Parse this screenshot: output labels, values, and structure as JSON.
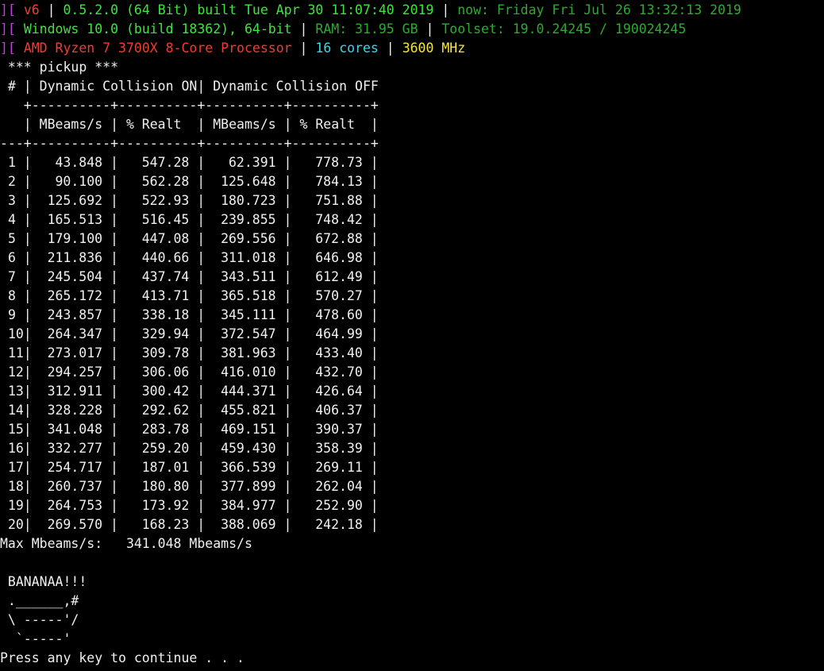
{
  "header": {
    "line1": {
      "bracket": "][",
      "version": "v6",
      "sep1": " | ",
      "build": "0.5.2.0 (64 Bit) built Tue Apr 30 11:07:40 2019",
      "sep2": " | ",
      "now": "now: Friday Fri Jul 26 13:32:13 2019"
    },
    "line2": {
      "bracket": "][",
      "os": "Windows 10.0 (build 18362), 64-bit",
      "sep1": " | ",
      "ram": "RAM: 31.95 GB",
      "sep2": " | ",
      "toolset": "Toolset: 19.0.24245 / 190024245"
    },
    "line3": {
      "bracket": "][",
      "cpu": "AMD Ryzen 7 3700X 8-Core Processor",
      "sep1": " | ",
      "cores": "16 cores",
      "sep2": " | ",
      "mhz": "3600 MHz"
    }
  },
  "scene_line": " *** pickup ***",
  "table": {
    "group_header": " # | Dynamic Collision ON| Dynamic Collision OFF",
    "rule_top": "   +----------+----------+----------+----------+",
    "col_header": "   | MBeams/s | % Realt  | MBeams/s | % Realt  |",
    "rule_mid": "---+----------+----------+----------+----------+",
    "rows": [
      {
        "n": "1",
        "on_mbeams": "43.848",
        "on_realt": "547.28",
        "off_mbeams": "62.391",
        "off_realt": "778.73"
      },
      {
        "n": "2",
        "on_mbeams": "90.100",
        "on_realt": "562.28",
        "off_mbeams": "125.648",
        "off_realt": "784.13"
      },
      {
        "n": "3",
        "on_mbeams": "125.692",
        "on_realt": "522.93",
        "off_mbeams": "180.723",
        "off_realt": "751.88"
      },
      {
        "n": "4",
        "on_mbeams": "165.513",
        "on_realt": "516.45",
        "off_mbeams": "239.855",
        "off_realt": "748.42"
      },
      {
        "n": "5",
        "on_mbeams": "179.100",
        "on_realt": "447.08",
        "off_mbeams": "269.556",
        "off_realt": "672.88"
      },
      {
        "n": "6",
        "on_mbeams": "211.836",
        "on_realt": "440.66",
        "off_mbeams": "311.018",
        "off_realt": "646.98"
      },
      {
        "n": "7",
        "on_mbeams": "245.504",
        "on_realt": "437.74",
        "off_mbeams": "343.511",
        "off_realt": "612.49"
      },
      {
        "n": "8",
        "on_mbeams": "265.172",
        "on_realt": "413.71",
        "off_mbeams": "365.518",
        "off_realt": "570.27"
      },
      {
        "n": "9",
        "on_mbeams": "243.857",
        "on_realt": "338.18",
        "off_mbeams": "345.111",
        "off_realt": "478.60"
      },
      {
        "n": "10",
        "on_mbeams": "264.347",
        "on_realt": "329.94",
        "off_mbeams": "372.547",
        "off_realt": "464.99"
      },
      {
        "n": "11",
        "on_mbeams": "273.017",
        "on_realt": "309.78",
        "off_mbeams": "381.963",
        "off_realt": "433.40"
      },
      {
        "n": "12",
        "on_mbeams": "294.257",
        "on_realt": "306.06",
        "off_mbeams": "416.010",
        "off_realt": "432.70"
      },
      {
        "n": "13",
        "on_mbeams": "312.911",
        "on_realt": "300.42",
        "off_mbeams": "444.371",
        "off_realt": "426.64"
      },
      {
        "n": "14",
        "on_mbeams": "328.228",
        "on_realt": "292.62",
        "off_mbeams": "455.821",
        "off_realt": "406.37"
      },
      {
        "n": "15",
        "on_mbeams": "341.048",
        "on_realt": "283.78",
        "off_mbeams": "469.151",
        "off_realt": "390.37"
      },
      {
        "n": "16",
        "on_mbeams": "332.277",
        "on_realt": "259.20",
        "off_mbeams": "459.430",
        "off_realt": "358.39"
      },
      {
        "n": "17",
        "on_mbeams": "254.717",
        "on_realt": "187.01",
        "off_mbeams": "366.539",
        "off_realt": "269.11"
      },
      {
        "n": "18",
        "on_mbeams": "260.737",
        "on_realt": "180.80",
        "off_mbeams": "377.899",
        "off_realt": "262.04"
      },
      {
        "n": "19",
        "on_mbeams": "264.753",
        "on_realt": "173.92",
        "off_mbeams": "384.977",
        "off_realt": "252.90"
      },
      {
        "n": "20",
        "on_mbeams": "269.570",
        "on_realt": "168.23",
        "off_mbeams": "388.069",
        "off_realt": "242.18"
      }
    ]
  },
  "max_line": "Max Mbeams/s:   341.048 Mbeams/s",
  "ascii_art": [
    " BANANAA!!!",
    " .______,#",
    " \\ -----'/",
    "  `-----'"
  ],
  "prompt": "Press any key to continue . . .",
  "colors": {
    "background": "#000000",
    "text": "#f0f0f0",
    "magenta": "#c040d8",
    "red": "#f03c32",
    "green": "#3ce63c",
    "dark_green": "#2faa30",
    "cyan": "#3fd6ea",
    "yellow": "#f5e63c"
  }
}
